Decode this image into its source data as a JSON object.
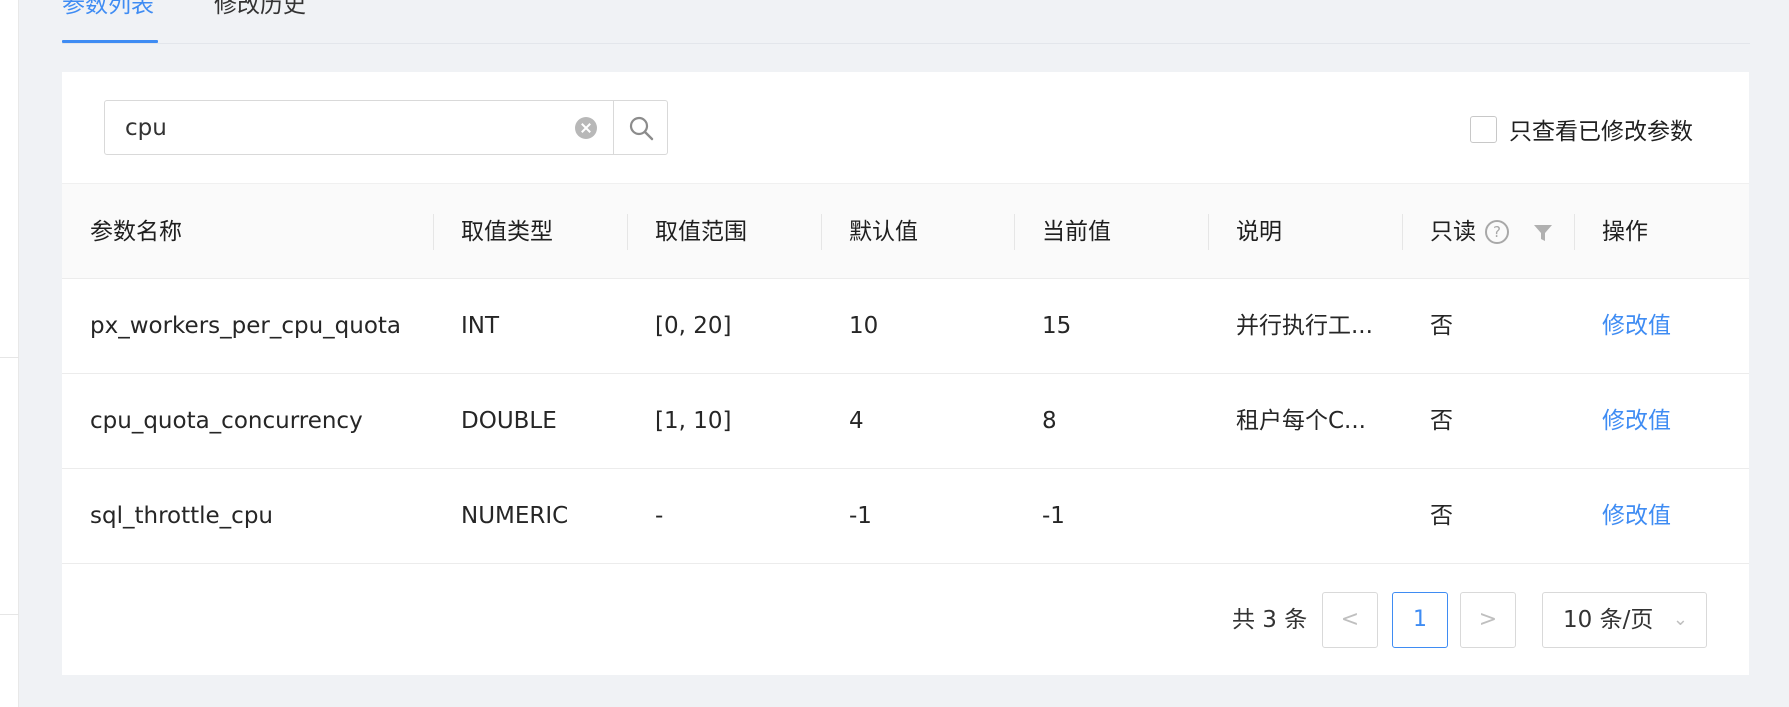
{
  "tabs": [
    {
      "label": "参数列表",
      "active": true
    },
    {
      "label": "修改历史",
      "active": false
    }
  ],
  "search": {
    "value": "cpu"
  },
  "filter": {
    "label": "只查看已修改参数",
    "checked": false
  },
  "table": {
    "headers": {
      "name": "参数名称",
      "type": "取值类型",
      "range": "取值范围",
      "default": "默认值",
      "current": "当前值",
      "desc": "说明",
      "readonly": "只读",
      "action": "操作"
    },
    "rows": [
      {
        "name": "px_workers_per_cpu_quota",
        "type": "INT",
        "range": "[0, 20]",
        "default": "10",
        "current": "15",
        "desc": "并行执行工...",
        "readonly": "否",
        "action": "修改值"
      },
      {
        "name": "cpu_quota_concurrency",
        "type": "DOUBLE",
        "range": "[1, 10]",
        "default": "4",
        "current": "8",
        "desc": "租户每个C...",
        "readonly": "否",
        "action": "修改值"
      },
      {
        "name": "sql_throttle_cpu",
        "type": "NUMERIC",
        "range": "-",
        "default": "-1",
        "current": "-1",
        "desc": "",
        "readonly": "否",
        "action": "修改值"
      }
    ]
  },
  "pagination": {
    "total_text": "共 3 条",
    "prev": "<",
    "current_page": "1",
    "next": ">",
    "page_size": "10 条/页"
  },
  "colors": {
    "accent": "#3f8cf3",
    "background": "#f0f2f5",
    "header_bg": "#fafafa"
  },
  "icons": [
    "clear-icon",
    "search-icon",
    "help-icon",
    "filter-icon",
    "chevron-down-icon"
  ]
}
